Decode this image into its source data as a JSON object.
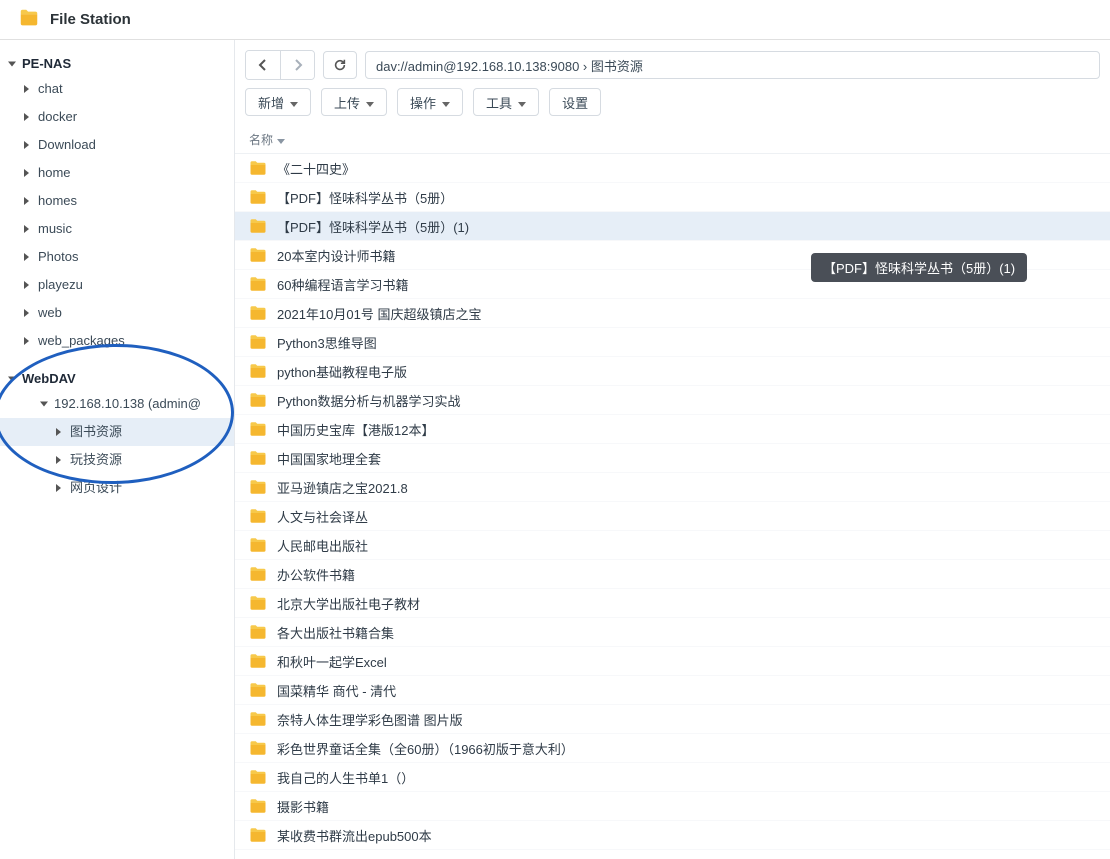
{
  "app": {
    "title": "File Station"
  },
  "sidebar": {
    "sections": [
      {
        "label": "PE-NAS",
        "expanded": true,
        "items": [
          {
            "label": "chat"
          },
          {
            "label": "docker"
          },
          {
            "label": "Download"
          },
          {
            "label": "home"
          },
          {
            "label": "homes"
          },
          {
            "label": "music"
          },
          {
            "label": "Photos"
          },
          {
            "label": "playezu"
          },
          {
            "label": "web"
          },
          {
            "label": "web_packages"
          }
        ]
      },
      {
        "label": "WebDAV",
        "expanded": true,
        "items": [
          {
            "label": "192.168.10.138 (admin@",
            "expanded": true,
            "children": [
              {
                "label": "图书资源",
                "selected": true
              },
              {
                "label": "玩技资源"
              },
              {
                "label": "网页设计"
              }
            ]
          }
        ]
      }
    ]
  },
  "pathbar": {
    "text": "dav://admin@192.168.10.138:9080 › 图书资源"
  },
  "toolbar": {
    "new": "新增",
    "upload": "上传",
    "action": "操作",
    "tools": "工具",
    "settings": "设置"
  },
  "columns": {
    "name": "名称"
  },
  "tooltip": {
    "text": "【PDF】怪味科学丛书（5册）(1)"
  },
  "files": [
    {
      "name": "《二十四史》"
    },
    {
      "name": "【PDF】怪味科学丛书（5册）"
    },
    {
      "name": "【PDF】怪味科学丛书（5册）(1)",
      "selected": true
    },
    {
      "name": "20本室内设计师书籍"
    },
    {
      "name": "60种编程语言学习书籍"
    },
    {
      "name": "2021年10月01号 国庆超级镇店之宝"
    },
    {
      "name": "Python3思维导图"
    },
    {
      "name": "python基础教程电子版"
    },
    {
      "name": "Python数据分析与机器学习实战"
    },
    {
      "name": "中国历史宝库【港版12本】"
    },
    {
      "name": "中国国家地理全套"
    },
    {
      "name": "亚马逊镇店之宝2021.8"
    },
    {
      "name": "人文与社会译丛"
    },
    {
      "name": "人民邮电出版社"
    },
    {
      "name": "办公软件书籍"
    },
    {
      "name": "北京大学出版社电子教材"
    },
    {
      "name": "各大出版社书籍合集"
    },
    {
      "name": "和秋叶一起学Excel"
    },
    {
      "name": "国菜精华 商代 - 清代"
    },
    {
      "name": "奈特人体生理学彩色图谱 图片版"
    },
    {
      "name": "彩色世界童话全集（全60册）（1966初版于意大利）"
    },
    {
      "name": "我自己的人生书单1（）"
    },
    {
      "name": "摄影书籍"
    },
    {
      "name": "某收费书群流出epub500本"
    }
  ],
  "icons": {
    "app": "folder-open",
    "folder": "folder"
  },
  "colors": {
    "accent": "#1f5fbf",
    "selection": "#e6eef7",
    "folder": "#f5b72f"
  }
}
